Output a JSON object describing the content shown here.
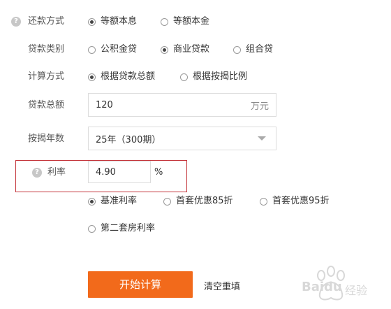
{
  "repayment_method": {
    "label": "还款方式",
    "help_icon": "question-icon",
    "options": [
      "等额本息",
      "等额本金"
    ],
    "selected": 0
  },
  "loan_type": {
    "label": "贷款类别",
    "options": [
      "公积金贷",
      "商业贷款",
      "组合贷"
    ],
    "selected": 1
  },
  "calc_method": {
    "label": "计算方式",
    "options": [
      "根据贷款总额",
      "根据按揭比例"
    ],
    "selected": 0
  },
  "loan_amount": {
    "label": "贷款总额",
    "value": "120",
    "unit": "万元"
  },
  "mortgage_years": {
    "label": "按揭年数",
    "value": "25年（300期）"
  },
  "interest_rate": {
    "label": "利率",
    "value": "4.90",
    "unit": "%",
    "options": [
      "基准利率",
      "首套优惠85折",
      "首套优惠95折",
      "第二套房利率"
    ],
    "selected": 0
  },
  "actions": {
    "calculate": "开始计算",
    "clear": "清空重填"
  },
  "watermark": {
    "logo_text": "Baidu",
    "suffix": "经验"
  },
  "colors": {
    "accent": "#f26a1b",
    "highlight_border": "#c4353b"
  }
}
